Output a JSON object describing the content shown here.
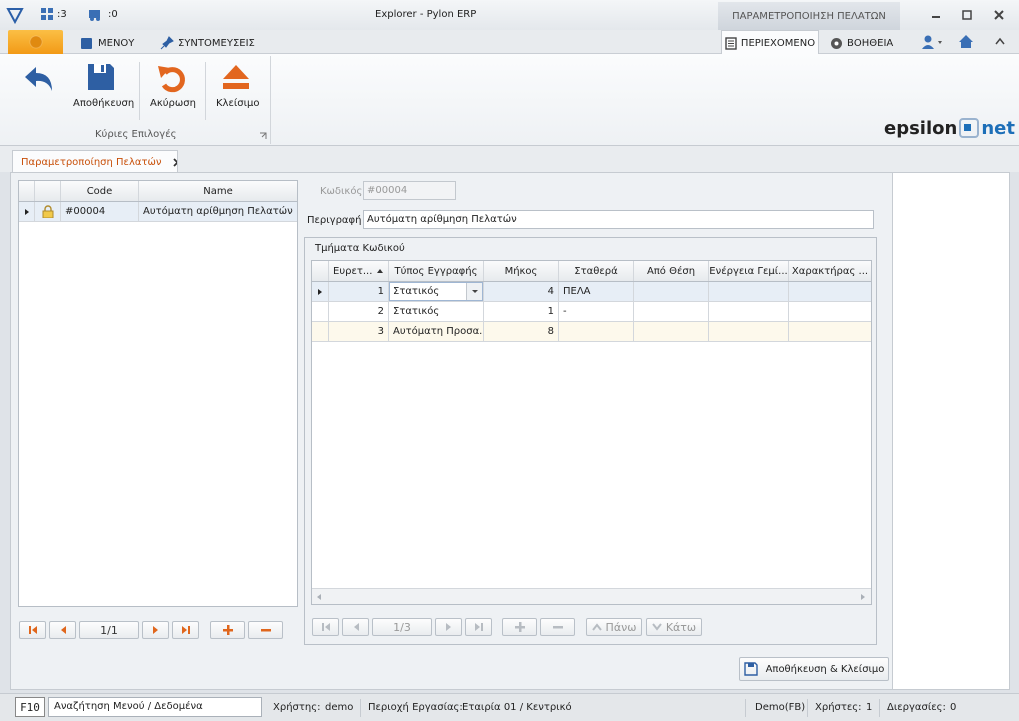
{
  "window": {
    "title": "Explorer - Pylon ERP",
    "context_tab": "ΠΑΡΑΜΕΤΡΟΠΟΙΗΣΗ ΠΕΛΑΤΩΝ",
    "count_a": ":3",
    "count_b": ":0"
  },
  "menubar": {
    "menu": "ΜΕΝΟΥ",
    "shortcuts": "ΣΥΝΤΟΜΕΥΣΕΙΣ",
    "content": "ΠΕΡΙΕΧΟΜΕΝΟ",
    "help": "ΒΟΗΘΕΙΑ"
  },
  "ribbon": {
    "save": "Αποθήκευση",
    "cancel": "Ακύρωση",
    "close": "Κλείσιμο",
    "group_label": "Κύριες Επιλογές",
    "brand_a": "epsilon",
    "brand_b": "net"
  },
  "doc_tab": {
    "label": "Παραμετροποίηση Πελατών"
  },
  "left_grid": {
    "headers": [
      "Code",
      "Name"
    ],
    "rows": [
      {
        "code": "#00004",
        "name": "Αυτόματη αρίθμηση Πελατών"
      }
    ],
    "pager": "1/1"
  },
  "form": {
    "code_label": "Κωδικός",
    "code_value": "#00004",
    "desc_label": "Περιγραφή",
    "desc_value": "Αυτόματη αρίθμηση Πελατών",
    "group_title": "Τμήματα Κωδικού"
  },
  "parts_grid": {
    "headers": [
      "Ευρετ...",
      "Τύπος Εγγραφής",
      "Μήκος",
      "Σταθερά",
      "Από Θέση",
      "Ενέργεια Γεμί...",
      "Χαρακτήρας ..."
    ],
    "rows": [
      {
        "idx": "1",
        "type": "Στατικός",
        "len": "4",
        "const": "ΠΕΛΑ"
      },
      {
        "idx": "2",
        "type": "Στατικός",
        "len": "1",
        "const": "-"
      },
      {
        "idx": "3",
        "type": "Αυτόματη Προσα...",
        "len": "8",
        "const": ""
      }
    ],
    "pager": "1/3",
    "up": "Πάνω",
    "down": "Κάτω"
  },
  "save_close": "Αποθήκευση & Κλείσιμο",
  "status": {
    "key": "F10",
    "search": "Αναζήτηση Μενού / Δεδομένα",
    "user_label": "Χρήστης:",
    "user": "demo",
    "area_label": "Περιοχή Εργασίας:",
    "area": "Εταιρία 01 / Κεντρικό",
    "db": "Demo(FB)",
    "users_label": "Χρήστες:",
    "users": "1",
    "proc_label": "Διεργασίες:",
    "proc": "0"
  },
  "colors": {
    "accent": "#c8500a",
    "orange_btn": "#f5a623",
    "selected_row": "#e7eef6",
    "brand_blue": "#1d6fb8"
  }
}
